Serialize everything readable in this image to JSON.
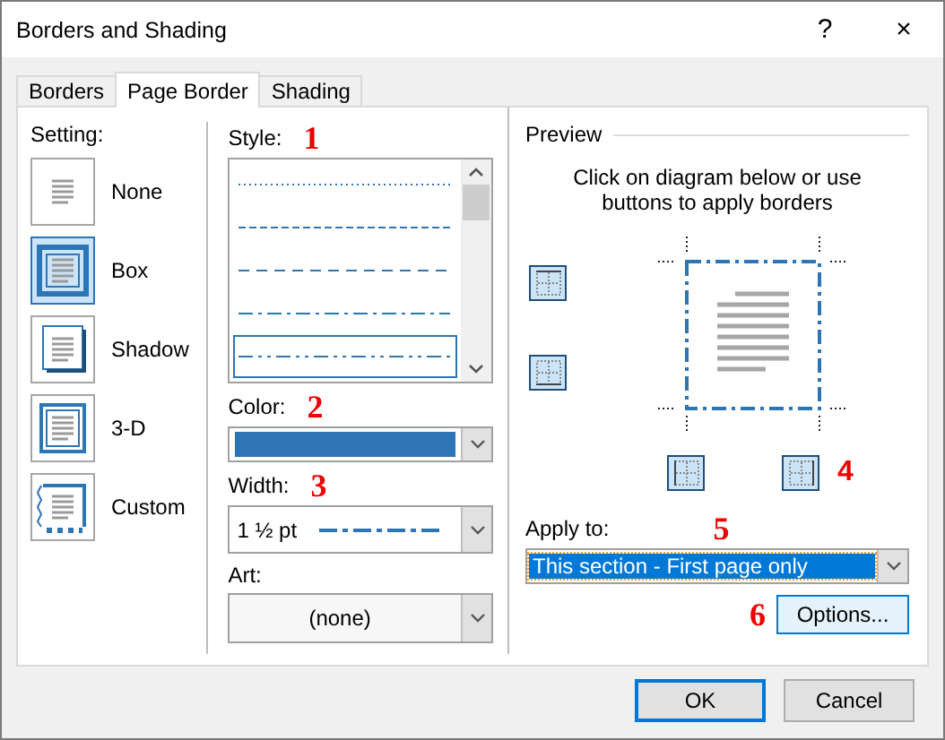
{
  "window": {
    "title": "Borders and Shading",
    "help": "?",
    "close": "×"
  },
  "tabs": [
    {
      "label": "Borders",
      "selected": false
    },
    {
      "label": "Page Border",
      "selected": true
    },
    {
      "label": "Shading",
      "selected": false
    }
  ],
  "setting": {
    "label": "Setting:",
    "items": [
      {
        "kind": "none",
        "label": "None",
        "selected": false
      },
      {
        "kind": "box",
        "label": "Box",
        "selected": true
      },
      {
        "kind": "shadow",
        "label": "Shadow",
        "selected": false
      },
      {
        "kind": "raised",
        "label": "3-D",
        "selected": false
      },
      {
        "kind": "custom",
        "label": "Custom",
        "selected": false
      }
    ]
  },
  "style": {
    "label": "Style:",
    "marker": "1",
    "items": [
      {
        "kind": "dotted",
        "selected": false
      },
      {
        "kind": "dashed-small",
        "selected": false
      },
      {
        "kind": "dashed",
        "selected": false
      },
      {
        "kind": "dash-dot",
        "selected": false
      },
      {
        "kind": "dash-dot-dot",
        "selected": true
      }
    ]
  },
  "color": {
    "label": "Color:",
    "marker": "2",
    "color": "#2e75b6"
  },
  "width": {
    "label": "Width:",
    "marker": "3",
    "value": "1 ½ pt"
  },
  "art": {
    "label": "Art:",
    "value": "(none)"
  },
  "preview": {
    "title": "Preview",
    "hint": "Click on diagram below or use buttons to apply borders",
    "marker": "4",
    "border_buttons": [
      {
        "kind": "top",
        "selected": true
      },
      {
        "kind": "bottom",
        "selected": true
      },
      {
        "kind": "left",
        "selected": true
      },
      {
        "kind": "right",
        "selected": true
      }
    ]
  },
  "apply_to": {
    "label": "Apply to:",
    "marker": "5",
    "value": "This section - First page only"
  },
  "options": {
    "label": "Options...",
    "marker": "6"
  },
  "buttons": [
    {
      "label": "OK",
      "default": true
    },
    {
      "label": "Cancel",
      "default": false
    }
  ]
}
